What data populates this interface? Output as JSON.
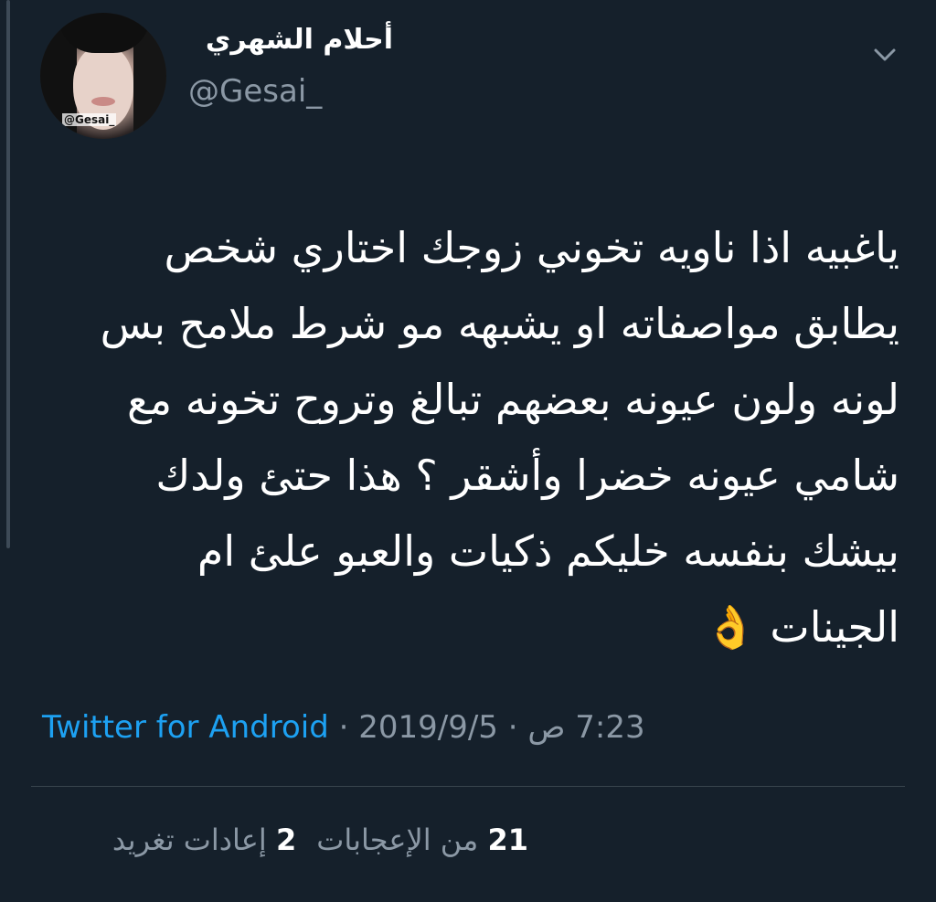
{
  "user": {
    "display_name": "أحلام الشهري",
    "handle": "@Gesai_",
    "avatar_tag": "@Gesai_"
  },
  "tweet": {
    "lines": [
      "ياغبيه اذا ناويه تخوني زوجك اختاري شخص",
      "يطابق مواصفاته او يشبهه مو شرط ملامح بس",
      "لونه ولون عيونه بعضهم تبالغ وتروح تخونه مع",
      "شامي عيونه خضرا وأشقر ؟ هذا حتئ ولدك",
      "بيشك بنفسه خليكم ذكيات والعبو علئ ام",
      "الجينات 👌"
    ]
  },
  "meta": {
    "source": "Twitter for Android",
    "separator": " · ",
    "date": "2019/9/5",
    "time": "7:23 ص"
  },
  "stats": {
    "retweets_count": "2",
    "retweets_label": "إعادات تغريد",
    "likes_count": "21",
    "likes_label": "من الإعجابات"
  },
  "icons": {
    "menu": "chevron-down-icon"
  },
  "colors": {
    "background": "#15202b",
    "link": "#1da1f2",
    "muted": "#8b98a5"
  }
}
